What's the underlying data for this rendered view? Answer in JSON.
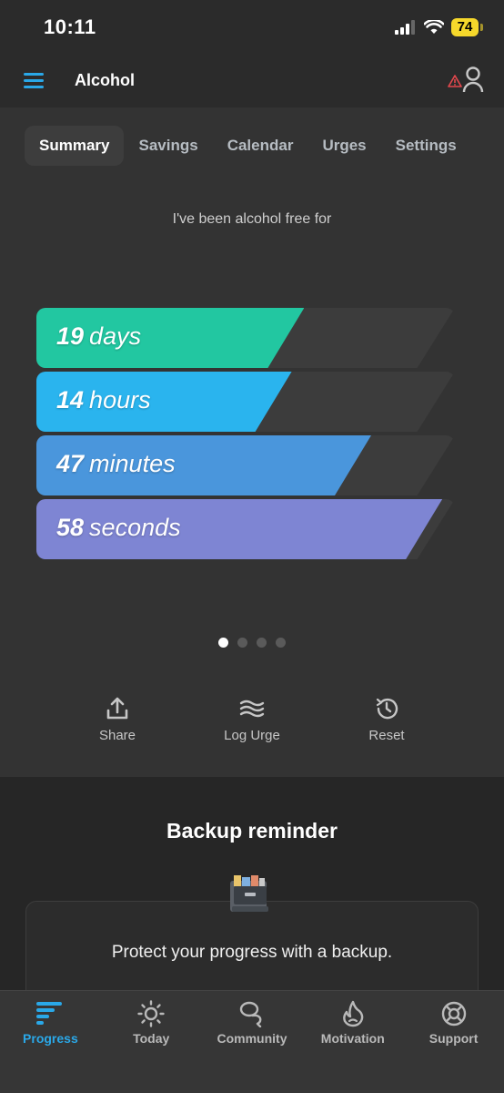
{
  "status_bar": {
    "time": "10:11",
    "battery": "74"
  },
  "header": {
    "title": "Alcohol"
  },
  "tabs": [
    {
      "label": "Summary",
      "active": true
    },
    {
      "label": "Savings",
      "active": false
    },
    {
      "label": "Calendar",
      "active": false
    },
    {
      "label": "Urges",
      "active": false
    },
    {
      "label": "Settings",
      "active": false
    }
  ],
  "intro_text": "I've been alcohol free for",
  "counters": [
    {
      "value": "19",
      "unit": "days",
      "fill_fraction": 0.64,
      "color": "#22c7a1"
    },
    {
      "value": "14",
      "unit": "hours",
      "fill_fraction": 0.61,
      "color": "#2ab4ee"
    },
    {
      "value": "47",
      "unit": "minutes",
      "fill_fraction": 0.8,
      "color": "#4a96dc"
    },
    {
      "value": "58",
      "unit": "seconds",
      "fill_fraction": 0.97,
      "color": "#7e85d3"
    }
  ],
  "pager": {
    "count": 4,
    "active_index": 0
  },
  "actions": [
    {
      "label": "Share",
      "icon": "share-icon"
    },
    {
      "label": "Log Urge",
      "icon": "waves-icon"
    },
    {
      "label": "Reset",
      "icon": "history-icon"
    }
  ],
  "backup": {
    "title": "Backup reminder",
    "message": "Protect your progress with a backup.",
    "icon": "file-cabinet-icon"
  },
  "tabbar": [
    {
      "label": "Progress",
      "icon": "progress-icon",
      "active": true
    },
    {
      "label": "Today",
      "icon": "sun-icon",
      "active": false
    },
    {
      "label": "Community",
      "icon": "community-icon",
      "active": false
    },
    {
      "label": "Motivation",
      "icon": "flame-icon",
      "active": false
    },
    {
      "label": "Support",
      "icon": "lifebuoy-icon",
      "active": false
    }
  ],
  "colors": {
    "accent": "#2aa8e8",
    "warning": "#e5484d",
    "battery": "#f6d82b"
  }
}
